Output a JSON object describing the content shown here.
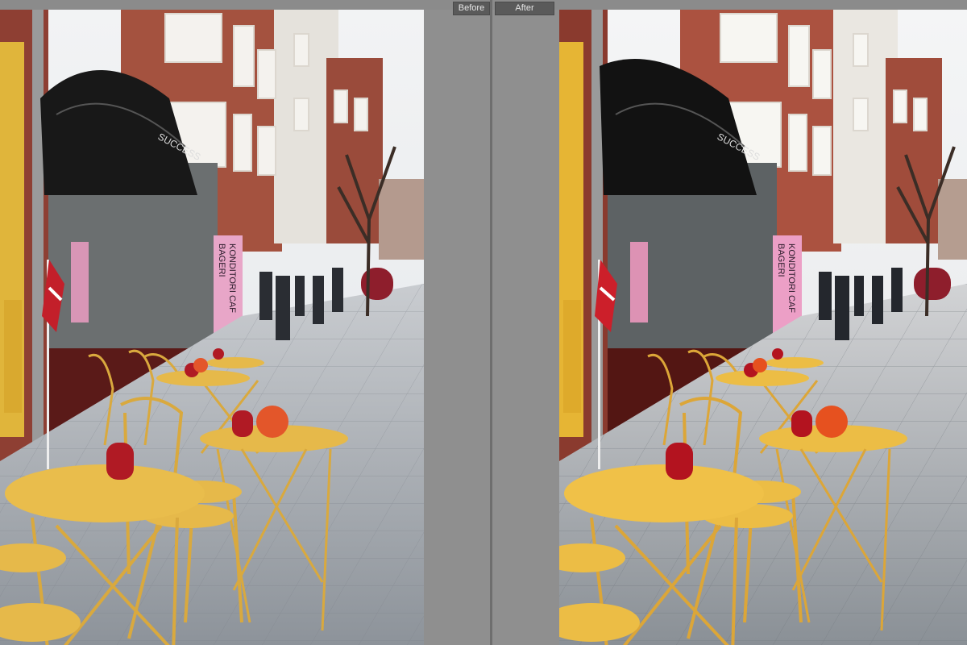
{
  "compare_view": {
    "before_label": "Before",
    "after_label": "After"
  },
  "photo": {
    "subject": "street-cafe-scene",
    "sign_text": "BAGERI KONDITORI CAF",
    "awning_text": "SUCCESS",
    "colors": {
      "sky": "#e9ecef",
      "brick": "#9a4a3a",
      "table": "#e6b94a",
      "awning": "#161616",
      "pavement": "#9ea4ab",
      "sign_pink": "#e8a6c8",
      "pumpkin": "#e3562a",
      "vase": "#b01a24"
    }
  }
}
